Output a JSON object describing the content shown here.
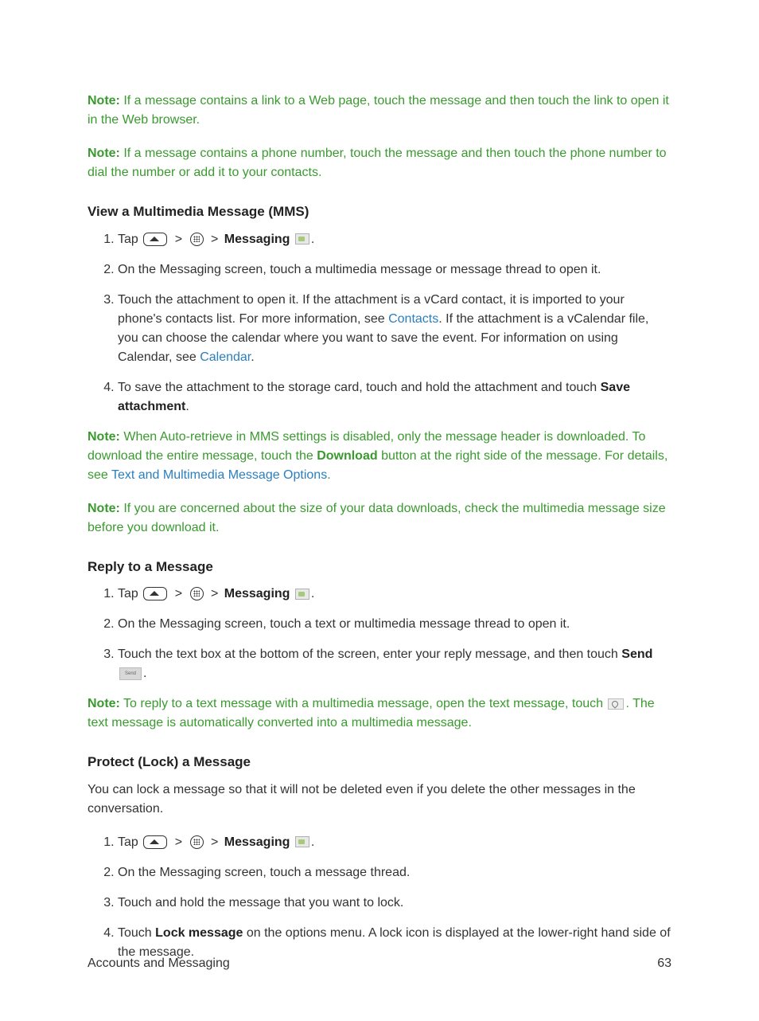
{
  "notes": {
    "n1_label": "Note:",
    "n1_text": " If a message contains a link to a Web page, touch the message and then touch the link to open it in the Web browser.",
    "n2_label": "Note:",
    "n2_text": " If a message contains a phone number, touch the message and then touch the phone number to dial the number or add it to your contacts.",
    "n3_label": "Note:",
    "n3_a": " When Auto-retrieve in MMS settings is disabled, only the message header is downloaded. To download the entire message, touch the ",
    "n3_b": "Download",
    "n3_c": " button at the right side of the message. For details, see ",
    "n3_link": "Text and Multimedia Message Options",
    "n3_d": ".",
    "n4_label": "Note:",
    "n4_text": " If you are concerned about the size of your data downloads, check the multimedia message size before you download it.",
    "n5_label": "Note:",
    "n5_a": " To reply to a text message with a multimedia message, open the text message, touch ",
    "n5_b": ". The text message is automatically converted into a multimedia message."
  },
  "sections": {
    "mms_heading": "View a Multimedia Message (MMS)",
    "reply_heading": "Reply to a Message",
    "lock_heading": "Protect (Lock) a Message"
  },
  "common": {
    "tap": "Tap ",
    "gt": ">",
    "messaging_bold": "Messaging",
    "period": "."
  },
  "mms_steps": {
    "s2": "On the Messaging screen, touch a multimedia message or message thread to open it.",
    "s3a": "Touch the attachment to open it. If the attachment is a vCard contact, it is imported to your phone's contacts list. For more information, see ",
    "s3_link1": "Contacts",
    "s3b": ". If the attachment is a vCalendar file, you can choose the calendar where you want to save the event. For information on using Calendar, see ",
    "s3_link2": "Calendar",
    "s3c": ".",
    "s4a": "To save the attachment to the storage card, touch and hold the attachment and touch ",
    "s4b": "Save attachment",
    "s4c": "."
  },
  "reply_steps": {
    "s2": "On the Messaging screen, touch a text or multimedia message thread to open it.",
    "s3a": "Touch the text box at the bottom of the screen, enter your reply message, and then touch ",
    "s3b": "Send",
    "s3c": "."
  },
  "lock_intro": "You can lock a message so that it will not be deleted even if you delete the other messages in the conversation.",
  "lock_steps": {
    "s2": "On the Messaging screen, touch a message thread.",
    "s3": "Touch and hold the message that you want to lock.",
    "s4a": "Touch ",
    "s4b": "Lock message",
    "s4c": " on the options menu. A lock icon is displayed at the lower-right hand side of the message."
  },
  "icon_send_text": "Send",
  "footer": {
    "section": "Accounts and Messaging",
    "page": "63"
  }
}
